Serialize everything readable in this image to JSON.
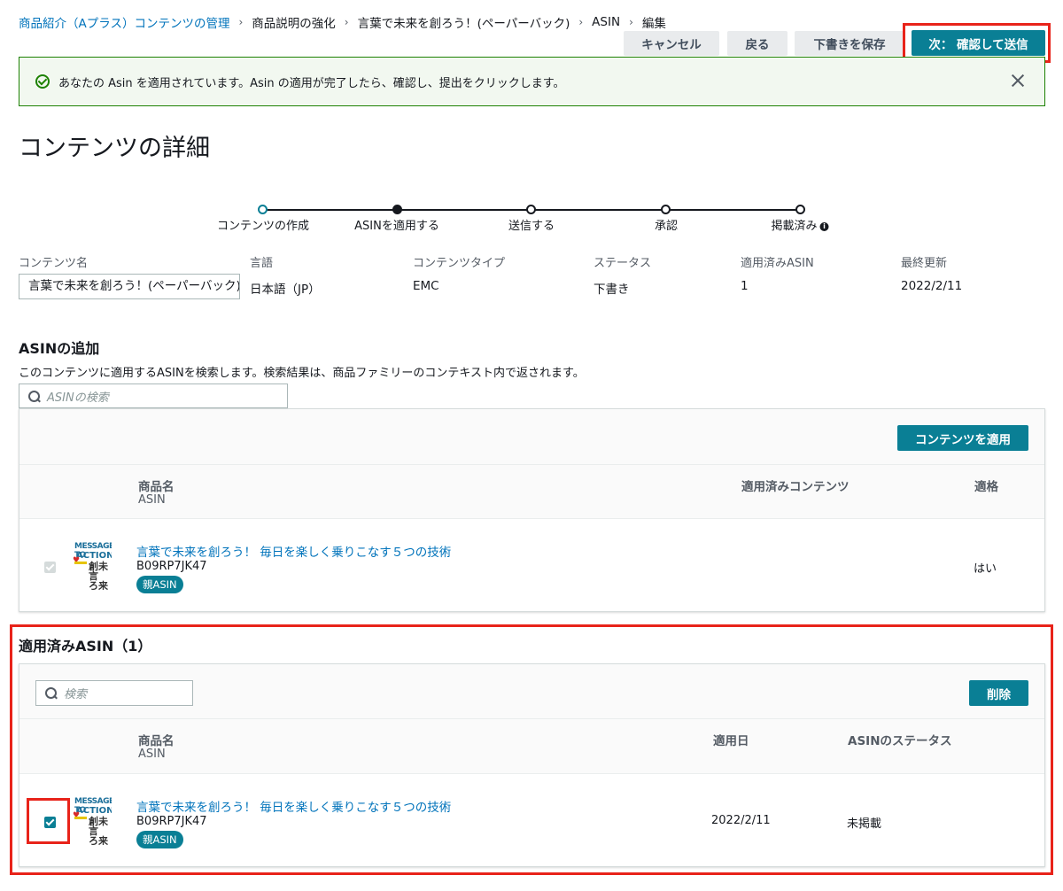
{
  "breadcrumb": [
    {
      "label": "商品紹介（Aプラス）コンテンツの管理"
    },
    {
      "label": "商品説明の強化"
    },
    {
      "label": "言葉で未来を創ろう！(ペーパーバック)"
    },
    {
      "label": "ASIN"
    },
    {
      "label": "編集"
    }
  ],
  "actions": {
    "cancel": "キャンセル",
    "back": "戻る",
    "save_draft": "下書きを保存",
    "next": "次： 確認して送信"
  },
  "flash": {
    "message": "あなたの Asin を適用されています。Asin の適用が完了したら、確認し、提出をクリックします。"
  },
  "page_title": "コンテンツの詳細",
  "steps": [
    {
      "label": "コンテンツの作成"
    },
    {
      "label": "ASINを適用する"
    },
    {
      "label": "送信する"
    },
    {
      "label": "承認"
    },
    {
      "label": "掲載済み"
    }
  ],
  "meta": {
    "content_name_label": "コンテンツ名",
    "content_name_value": "言葉で未来を創ろう！(ペーパーバック)",
    "language_label": "言語",
    "language_value": "日本語（JP）",
    "type_label": "コンテンツタイプ",
    "type_value": "EMC",
    "status_label": "ステータス",
    "status_value": "下書き",
    "applied_label": "適用済みASIN",
    "applied_value": "1",
    "updated_label": "最終更新",
    "updated_value": "2022/2/11"
  },
  "add_asin": {
    "title": "ASINの追加",
    "description": "このコンテンツに適用するASINを検索します。検索結果は、商品ファミリーのコンテキスト内で返されます。",
    "search_placeholder": "ASINの検索",
    "apply_button": "コンテンツを適用",
    "col_product": "商品名",
    "col_asin": "ASIN",
    "col_applied_content": "適用済みコンテンツ",
    "col_eligible": "適格",
    "row": {
      "product": "言葉で未来を創ろう！ 毎日を楽しく乗りこなす５つの技術",
      "asin": "B09RP7JK47",
      "badge": "親ASIN",
      "eligible": "はい"
    }
  },
  "applied_asin": {
    "title": "適用済みASIN（1）",
    "search_placeholder": "検索",
    "delete_button": "削除",
    "col_product": "商品名",
    "col_asin": "ASIN",
    "col_applied_date": "適用日",
    "col_status": "ASINのステータス",
    "row": {
      "product": "言葉で未来を創ろう！ 毎日を楽しく乗りこなす５つの技術",
      "asin": "B09RP7JK47",
      "badge": "親ASIN",
      "applied_date": "2022/2/11",
      "status": "未掲載"
    }
  },
  "thumbnail": {
    "line1": "MESSAGE TO",
    "line2": "ACTION",
    "line3": "創未言 ろ来葉 うをで"
  },
  "colors": {
    "primary": "#0a7f95",
    "link": "#0073bb",
    "highlight": "#e8231a",
    "success": "#1d8102"
  }
}
